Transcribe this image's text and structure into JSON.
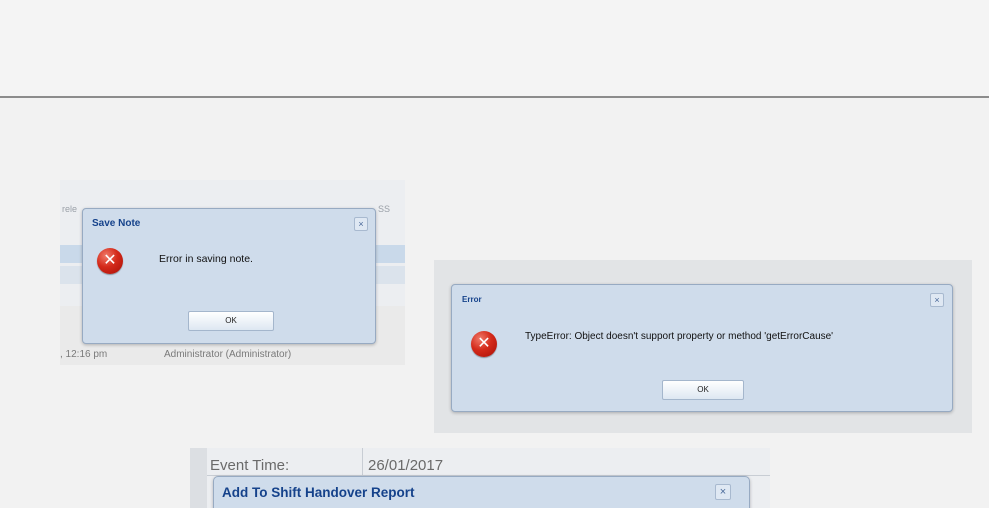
{
  "shot1": {
    "bg_left": "rele",
    "bg_right": "SS",
    "time": ", 12:16 pm",
    "user": "Administrator (Administrator)",
    "dialog": {
      "title": "Save Note",
      "close": "×",
      "icon": "error-x-icon",
      "icon_glyph": "✕",
      "message": "Error in saving note.",
      "ok": "OK"
    }
  },
  "shot2": {
    "dialog": {
      "title": "Error",
      "close": "×",
      "icon": "error-x-icon",
      "icon_glyph": "✕",
      "message": "TypeError: Object doesn't support property or method 'getErrorCause'",
      "ok": "OK"
    }
  },
  "shot3": {
    "field_label": "Event Time:",
    "field_value": "26/01/2017",
    "dialog": {
      "title": "Add To Shift Handover Report",
      "close": "×"
    }
  },
  "colors": {
    "dialog_bg": "#cfdceb",
    "title_blue": "#15428b",
    "error_red": "#d42a1a"
  }
}
